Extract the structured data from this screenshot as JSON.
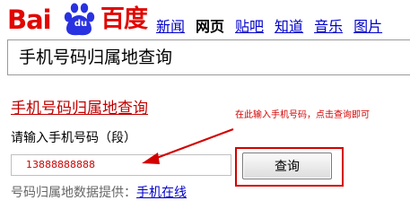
{
  "logo": {
    "bai_text": "Bai",
    "du_text": "du",
    "cn_text": "百度"
  },
  "nav": {
    "items": [
      {
        "label": "新闻",
        "current": false
      },
      {
        "label": "网页",
        "current": true
      },
      {
        "label": "贴吧",
        "current": false
      },
      {
        "label": "知道",
        "current": false
      },
      {
        "label": "音乐",
        "current": false
      },
      {
        "label": "图片",
        "current": false
      }
    ]
  },
  "search": {
    "value": "手机号码归属地查询"
  },
  "result": {
    "title": "手机号码归属地查询",
    "input_label": "请输入手机号码（段）",
    "phone_value": "13888888888",
    "query_button": "查询",
    "provider_prefix": "号码归属地数据提供：",
    "provider_link": "手机在线"
  },
  "annotation": {
    "text": "在此输入手机号码，点击查询即可"
  },
  "colors": {
    "baidu_red": "#e10602",
    "paw_blue": "#2932e1",
    "link_blue": "#0000cc",
    "annotation_red": "#d40000"
  }
}
